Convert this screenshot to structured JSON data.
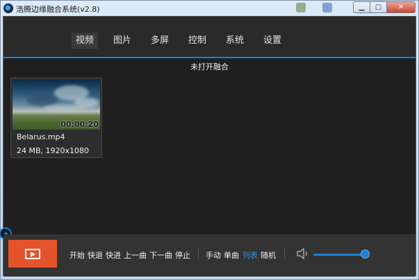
{
  "window": {
    "title": "浩腾边缘融合系统(v2.8)"
  },
  "nav": {
    "tabs": [
      {
        "label": "视频",
        "active": true
      },
      {
        "label": "图片",
        "active": false
      },
      {
        "label": "多屏",
        "active": false
      },
      {
        "label": "控制",
        "active": false
      },
      {
        "label": "系统",
        "active": false
      },
      {
        "label": "设置",
        "active": false
      }
    ]
  },
  "status_text": "未打开融合",
  "media": {
    "items": [
      {
        "name": "Belarus.mp4",
        "info": "24 MB, 1920x1080",
        "duration": "00:00:20",
        "thumbnail": "sky-clouds-landscape"
      }
    ]
  },
  "controls": {
    "play_icon": "play-icon",
    "playback": [
      "开始",
      "快退",
      "快进",
      "上一曲",
      "下一曲",
      "停止"
    ],
    "modes": [
      {
        "label": "手动",
        "active": false
      },
      {
        "label": "单曲",
        "active": false
      },
      {
        "label": "列表",
        "active": true
      },
      {
        "label": "随机",
        "active": false
      }
    ],
    "volume_icon": "speaker-icon",
    "volume": 1.0
  },
  "colors": {
    "accent": "#1f7fd1",
    "play_button": "#e5532c",
    "background": "#1f1f1f"
  }
}
